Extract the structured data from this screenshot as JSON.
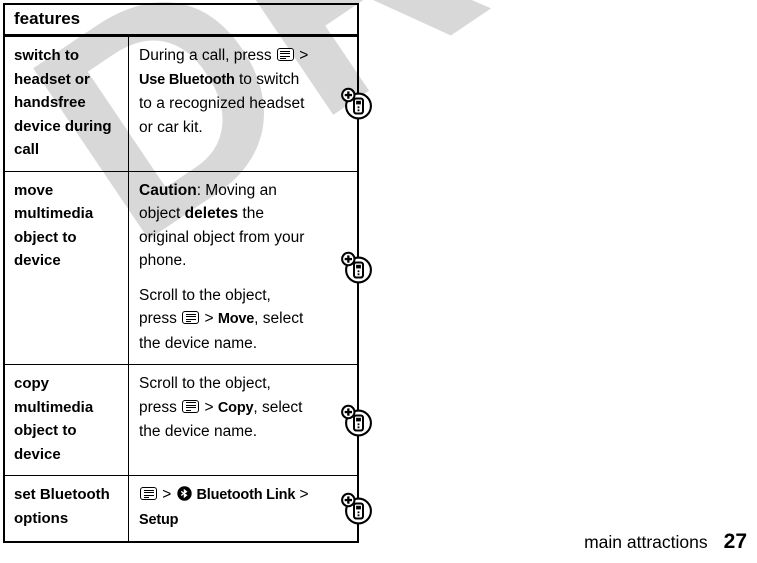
{
  "watermark": {
    "text": "DRAFT"
  },
  "table": {
    "header": "features",
    "rows": [
      {
        "label": "switch to headset or handsfree device during call",
        "icon": "phone-add-icon",
        "paragraphs": [
          {
            "segments": [
              {
                "type": "text",
                "value": "During a call, press "
              },
              {
                "type": "menu-key"
              },
              {
                "type": "gt",
                "value": " > "
              },
              {
                "type": "cmd",
                "value": "Use Bluetooth"
              },
              {
                "type": "text",
                "value": " to switch to a recognized headset or car kit."
              }
            ]
          }
        ]
      },
      {
        "label": "move multimedia object to device",
        "icon": "phone-add-icon",
        "paragraphs": [
          {
            "segments": [
              {
                "type": "bold",
                "value": "Caution"
              },
              {
                "type": "text",
                "value": ": Moving an object "
              },
              {
                "type": "bold",
                "value": "deletes"
              },
              {
                "type": "text",
                "value": " the original object from your phone."
              }
            ]
          },
          {
            "segments": [
              {
                "type": "text",
                "value": "Scroll to the object, press "
              },
              {
                "type": "menu-key"
              },
              {
                "type": "gt",
                "value": " > "
              },
              {
                "type": "cmd",
                "value": "Move"
              },
              {
                "type": "text",
                "value": ", select the device name."
              }
            ]
          }
        ]
      },
      {
        "label": "copy multimedia object to device",
        "icon": "phone-add-icon",
        "paragraphs": [
          {
            "segments": [
              {
                "type": "text",
                "value": "Scroll to the object, press "
              },
              {
                "type": "menu-key"
              },
              {
                "type": "gt",
                "value": " > "
              },
              {
                "type": "cmd",
                "value": "Copy"
              },
              {
                "type": "text",
                "value": ", select the device name."
              }
            ]
          }
        ]
      },
      {
        "label": "set Bluetooth options",
        "icon": "phone-add-icon",
        "paragraphs": [
          {
            "segments": [
              {
                "type": "menu-key"
              },
              {
                "type": "gt",
                "value": " > "
              },
              {
                "type": "bluetooth"
              },
              {
                "type": "cmd",
                "value": " Bluetooth Link"
              },
              {
                "type": "gt",
                "value": " > "
              },
              {
                "type": "cmd",
                "value": "Setup"
              }
            ]
          }
        ]
      }
    ]
  },
  "footer": {
    "chapter": "main attractions",
    "page_number": "27"
  },
  "colors": {
    "text": "#000000",
    "rule": "#000000",
    "watermark": "#d8d8d8",
    "page_background": "#ffffff"
  }
}
